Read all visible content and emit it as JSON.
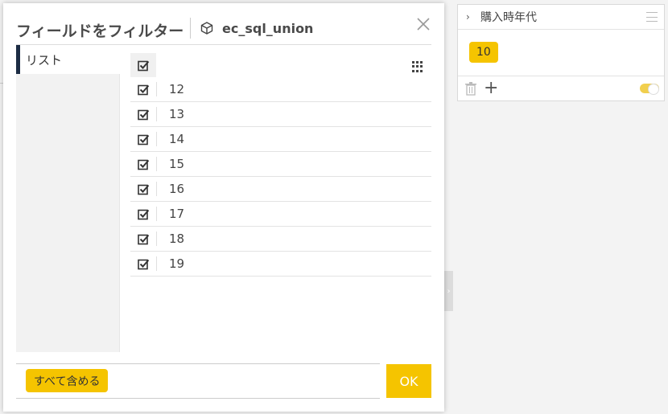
{
  "dialog": {
    "title": "フィールドをフィルター",
    "datasource": "ec_sql_union",
    "tab_label": "リスト",
    "items": [
      {
        "label": "12",
        "checked": true
      },
      {
        "label": "13",
        "checked": true
      },
      {
        "label": "14",
        "checked": true
      },
      {
        "label": "15",
        "checked": true
      },
      {
        "label": "16",
        "checked": true
      },
      {
        "label": "17",
        "checked": true
      },
      {
        "label": "18",
        "checked": true
      },
      {
        "label": "19",
        "checked": true
      }
    ],
    "include_all_label": "すべて含める",
    "ok_label": "OK"
  },
  "field_card": {
    "title": "購入時年代",
    "chip_value": "10",
    "toggle_on": true
  },
  "colors": {
    "accent": "#f5c400",
    "tab_indicator": "#1c2c44"
  },
  "icons": [
    "cube-icon",
    "close-icon",
    "checkbox-checked-icon",
    "grid-dots-icon",
    "chevron-right-icon",
    "hamburger-menu-icon",
    "trash-icon",
    "plus-icon",
    "toggle-switch"
  ]
}
